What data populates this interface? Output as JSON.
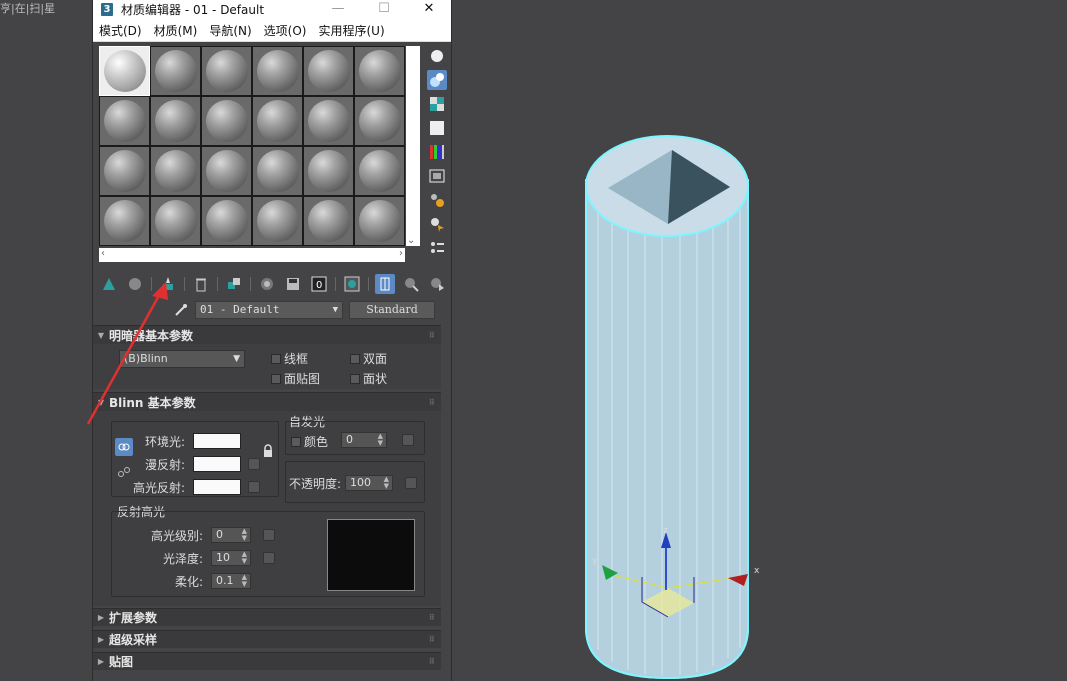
{
  "window": {
    "title": "材质编辑器 - 01 - Default",
    "app_icon_label": "3",
    "minimize": "—",
    "maximize": "☐",
    "close": "✕"
  },
  "background": {
    "left_edge_text": "亨|在|扫|星"
  },
  "menu": {
    "items": [
      "模式(D)",
      "材质(M)",
      "导航(N)",
      "选项(O)",
      "实用程序(U)"
    ]
  },
  "material": {
    "name": "01 - Default",
    "type": "Standard"
  },
  "shader_rollout": {
    "title": "明暗器基本参数",
    "shader": "(B)Blinn",
    "wire": "线框",
    "two_sided": "双面",
    "face_map": "面贴图",
    "faceted": "面状"
  },
  "blinn_rollout": {
    "title": "Blinn 基本参数",
    "ambient": "环境光:",
    "diffuse": "漫反射:",
    "specular": "高光反射:",
    "self_illum_group": "自发光",
    "color": "颜色",
    "self_illum_value": "0",
    "opacity_label": "不透明度:",
    "opacity_value": "100",
    "spec_group": "反射高光",
    "spec_level_label": "高光级别:",
    "spec_level_value": "0",
    "glossiness_label": "光泽度:",
    "glossiness_value": "10",
    "soften_label": "柔化:",
    "soften_value": "0.1"
  },
  "collapsed_rollouts": [
    "扩展参数",
    "超级采样",
    "贴图"
  ],
  "icons": {
    "sample_type": "sphere-icon",
    "backlight": "backlight-icon",
    "background": "checker-background-icon",
    "tiling": "sample-uv-tiling-icon",
    "video_check": "video-color-check-icon",
    "preview": "make-preview-icon",
    "options": "options-icon",
    "select_by_material": "select-by-material-icon",
    "navigator": "material-navigator-icon"
  },
  "colors": {
    "accent": "#5c8ac4",
    "panel": "#444446",
    "selection_cyan": "#7ff6ff",
    "annotation_red": "#e03030"
  },
  "scene": {
    "axis_x": "x",
    "axis_y": "y",
    "axis_z": "z"
  }
}
